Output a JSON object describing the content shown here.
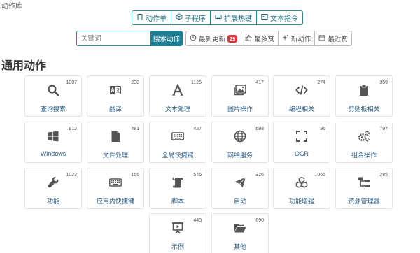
{
  "page": {
    "title": "动作库"
  },
  "tabs": [
    {
      "label": "动作单",
      "icon": "clipboard-icon"
    },
    {
      "label": "子程序",
      "icon": "cube-icon"
    },
    {
      "label": "扩展热键",
      "icon": "keyboard-icon"
    },
    {
      "label": "文本指令",
      "icon": "terminal-icon"
    }
  ],
  "search": {
    "placeholder": "关键词",
    "button_label": "搜索动作"
  },
  "filters": [
    {
      "label": "最新更新",
      "icon": "history-icon",
      "badge": "29"
    },
    {
      "label": "最多赞",
      "icon": "thumbs-up-icon"
    },
    {
      "label": "新动作",
      "icon": "sparkle-icon"
    },
    {
      "label": "最近赞",
      "icon": "calendar-icon"
    }
  ],
  "section": {
    "title": "通用动作"
  },
  "cards": [
    {
      "label": "查询搜索",
      "count": "1007",
      "icon": "search-icon"
    },
    {
      "label": "翻译",
      "count": "238",
      "icon": "translate-icon"
    },
    {
      "label": "文本处理",
      "count": "1125",
      "icon": "font-icon"
    },
    {
      "label": "图片操作",
      "count": "417",
      "icon": "image-icon"
    },
    {
      "label": "编程相关",
      "count": "274",
      "icon": "code-icon"
    },
    {
      "label": "剪贴板相关",
      "count": "359",
      "icon": "clipboard-icon"
    },
    {
      "label": "Windows",
      "count": "912",
      "icon": "windows-icon"
    },
    {
      "label": "文件处理",
      "count": "481",
      "icon": "file-icon"
    },
    {
      "label": "全局快捷键",
      "count": "427",
      "icon": "keyboard-icon"
    },
    {
      "label": "网络服务",
      "count": "698",
      "icon": "globe-icon"
    },
    {
      "label": "OCR",
      "count": "96",
      "icon": "scan-icon"
    },
    {
      "label": "组合操作",
      "count": "797",
      "icon": "gears-icon"
    },
    {
      "label": "功能",
      "count": "1023",
      "icon": "wrench-icon"
    },
    {
      "label": "应用内快捷键",
      "count": "155",
      "icon": "keyboard-icon"
    },
    {
      "label": "脚本",
      "count": "546",
      "icon": "scroll-icon"
    },
    {
      "label": "启动",
      "count": "326",
      "icon": "paper-plane-icon"
    },
    {
      "label": "功能增强",
      "count": "1065",
      "icon": "cubes-icon"
    },
    {
      "label": "资源管理器",
      "count": "285",
      "icon": "sitemap-icon"
    },
    {
      "label": "示例",
      "count": "445",
      "icon": "presentation-icon"
    },
    {
      "label": "其他",
      "count": "690",
      "icon": "folder-open-icon"
    }
  ]
}
